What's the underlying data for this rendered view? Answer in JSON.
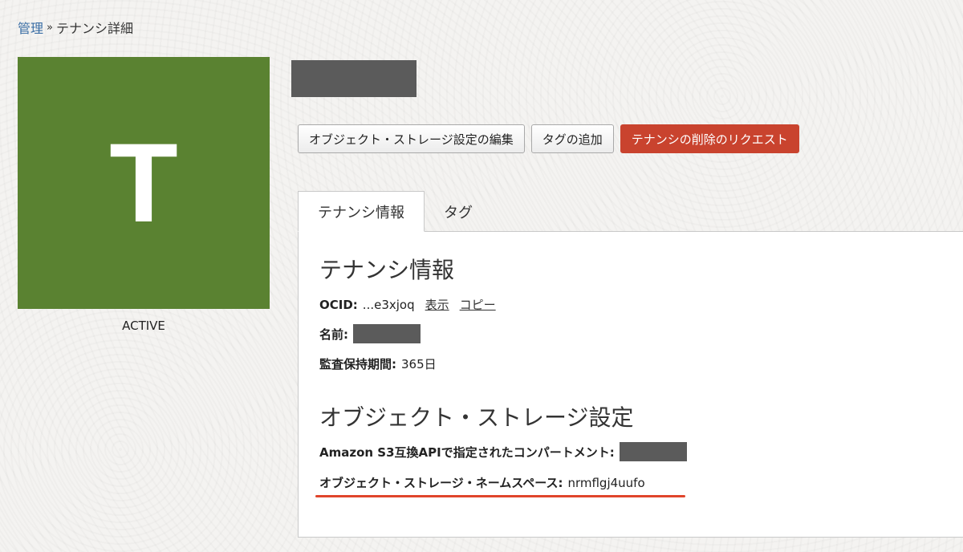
{
  "breadcrumb": {
    "root": "管理",
    "separator": "»",
    "current": "テナンシ詳細"
  },
  "tile": {
    "letter": "T",
    "status": "ACTIVE",
    "color": "#5a8231"
  },
  "actions": {
    "edit_storage": "オブジェクト・ストレージ設定の編集",
    "add_tag": "タグの追加",
    "request_delete": "テナンシの削除のリクエスト"
  },
  "tabs": [
    {
      "label": "テナンシ情報",
      "active": true
    },
    {
      "label": "タグ",
      "active": false
    }
  ],
  "tenancy_info": {
    "heading": "テナンシ情報",
    "ocid_label": "OCID:",
    "ocid_value": "...e3xjoq",
    "show_link": "表示",
    "copy_link": "コピー",
    "name_label": "名前:",
    "audit_label": "監査保持期間:",
    "audit_value": "365日"
  },
  "storage_settings": {
    "heading": "オブジェクト・ストレージ設定",
    "s3_label": "Amazon S3互換APIで指定されたコンパートメント:",
    "namespace_label": "オブジェクト・ストレージ・ネームスペース:",
    "namespace_value": "nrmflgj4uufo"
  },
  "colors": {
    "danger": "#c9432e",
    "highlight": "#e0452b",
    "link": "#3a6ea5"
  }
}
